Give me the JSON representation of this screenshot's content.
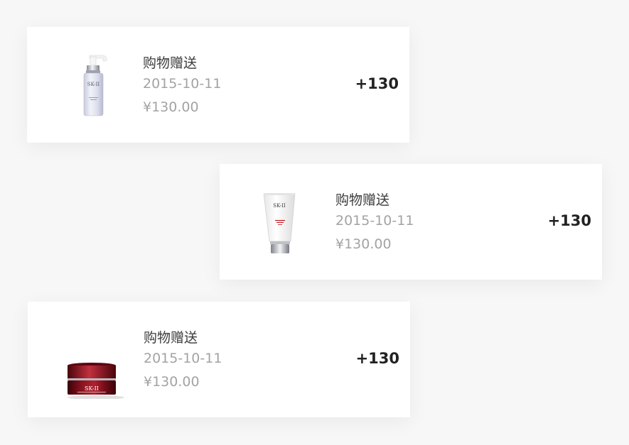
{
  "records": [
    {
      "product_icon": "lotion-bottle-icon",
      "title": "购物赠送",
      "date": "2015-10-11",
      "price": "¥130.00",
      "points": "+130",
      "brand_mark": "SK-II"
    },
    {
      "product_icon": "cleanser-tube-icon",
      "title": "购物赠送",
      "date": "2015-10-11",
      "price": "¥130.00",
      "points": "+130",
      "brand_mark": "SK-II"
    },
    {
      "product_icon": "cream-jar-icon",
      "title": "购物赠送",
      "date": "2015-10-11",
      "price": "¥130.00",
      "points": "+130",
      "brand_mark": "SK-II"
    }
  ],
  "colors": {
    "background": "#f7f7f7",
    "card": "#ffffff",
    "title_text": "#3c3c3c",
    "secondary_text": "#a3a3a3",
    "points_text": "#222222",
    "jar_red": "#7a0d1a",
    "tube_red": "#c4161c"
  }
}
